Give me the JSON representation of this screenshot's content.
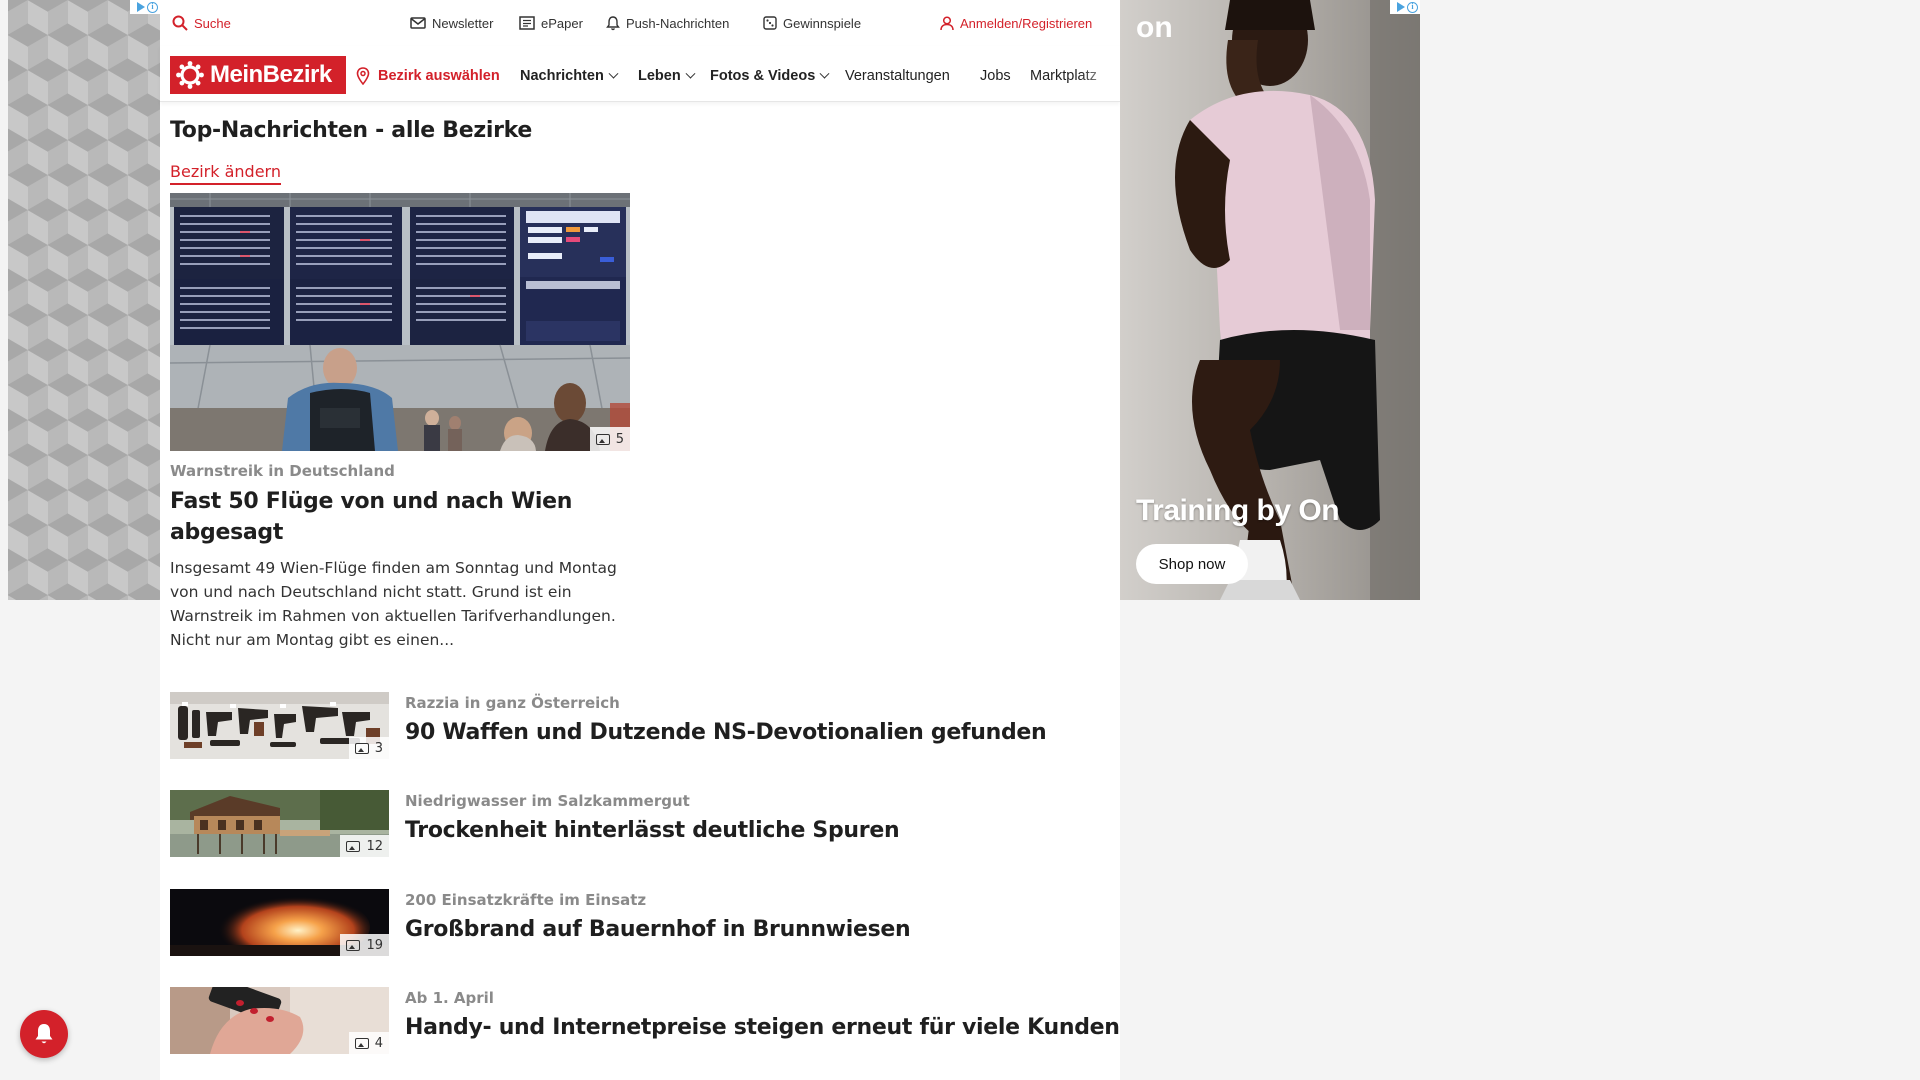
{
  "topbar": {
    "search": "Suche",
    "newsletter": "Newsletter",
    "epaper": "ePaper",
    "push": "Push-Nachrichten",
    "contests": "Gewinnspiele",
    "login": "Anmelden/Registrieren"
  },
  "nav": {
    "logo": "MeinBezirk",
    "select_district": "Bezirk auswählen",
    "items": [
      "Nachrichten",
      "Leben",
      "Fotos & Videos",
      "Veranstaltungen",
      "Jobs",
      "Marktplatz"
    ]
  },
  "page": {
    "title": "Top-Nachrichten - alle Bezirke",
    "change_district": "Bezirk ändern"
  },
  "hero": {
    "kicker": "Warnstreik in Deutschland",
    "headline": "Fast 50 Flüge von und nach Wien abgesagt",
    "teaser": "Insgesamt 49 Wien-Flüge finden am Sonntag und Montag von und nach Deutschland nicht statt. Grund ist ein Warnstreik im Rahmen von aktuellen Tarifverhandlungen. Nicht nur am Montag gibt es einen...",
    "image_count": "5"
  },
  "articles": [
    {
      "kicker": "Razzia in ganz Österreich",
      "headline": "90 Waffen und Dutzende NS-Devotionalien gefunden",
      "image_count": "3"
    },
    {
      "kicker": "Niedrigwasser im Salzkammergut",
      "headline": "Trockenheit hinterlässt deutliche Spuren",
      "image_count": "12"
    },
    {
      "kicker": "200 Einsatzkräfte im Einsatz",
      "headline": "Großbrand auf Bauernhof in Brunnwiesen",
      "image_count": "19"
    },
    {
      "kicker": "Ab 1. April",
      "headline": "Handy- und Internetpreise steigen erneut für viele Kunden",
      "image_count": "4"
    }
  ],
  "ad_right": {
    "brand": "on",
    "claim": "Training by On",
    "cta": "Shop now"
  },
  "colors": {
    "brand_red": "#d3212a",
    "kicker_gray": "#8a8a8a"
  },
  "icons": {
    "search": "search-icon",
    "newsletter": "mail-icon",
    "epaper": "newspaper-icon",
    "push": "bell-icon",
    "contests": "dice-icon",
    "login": "user-icon",
    "location": "pin-icon",
    "gallery": "gallery-icon",
    "notify": "bell-icon"
  }
}
